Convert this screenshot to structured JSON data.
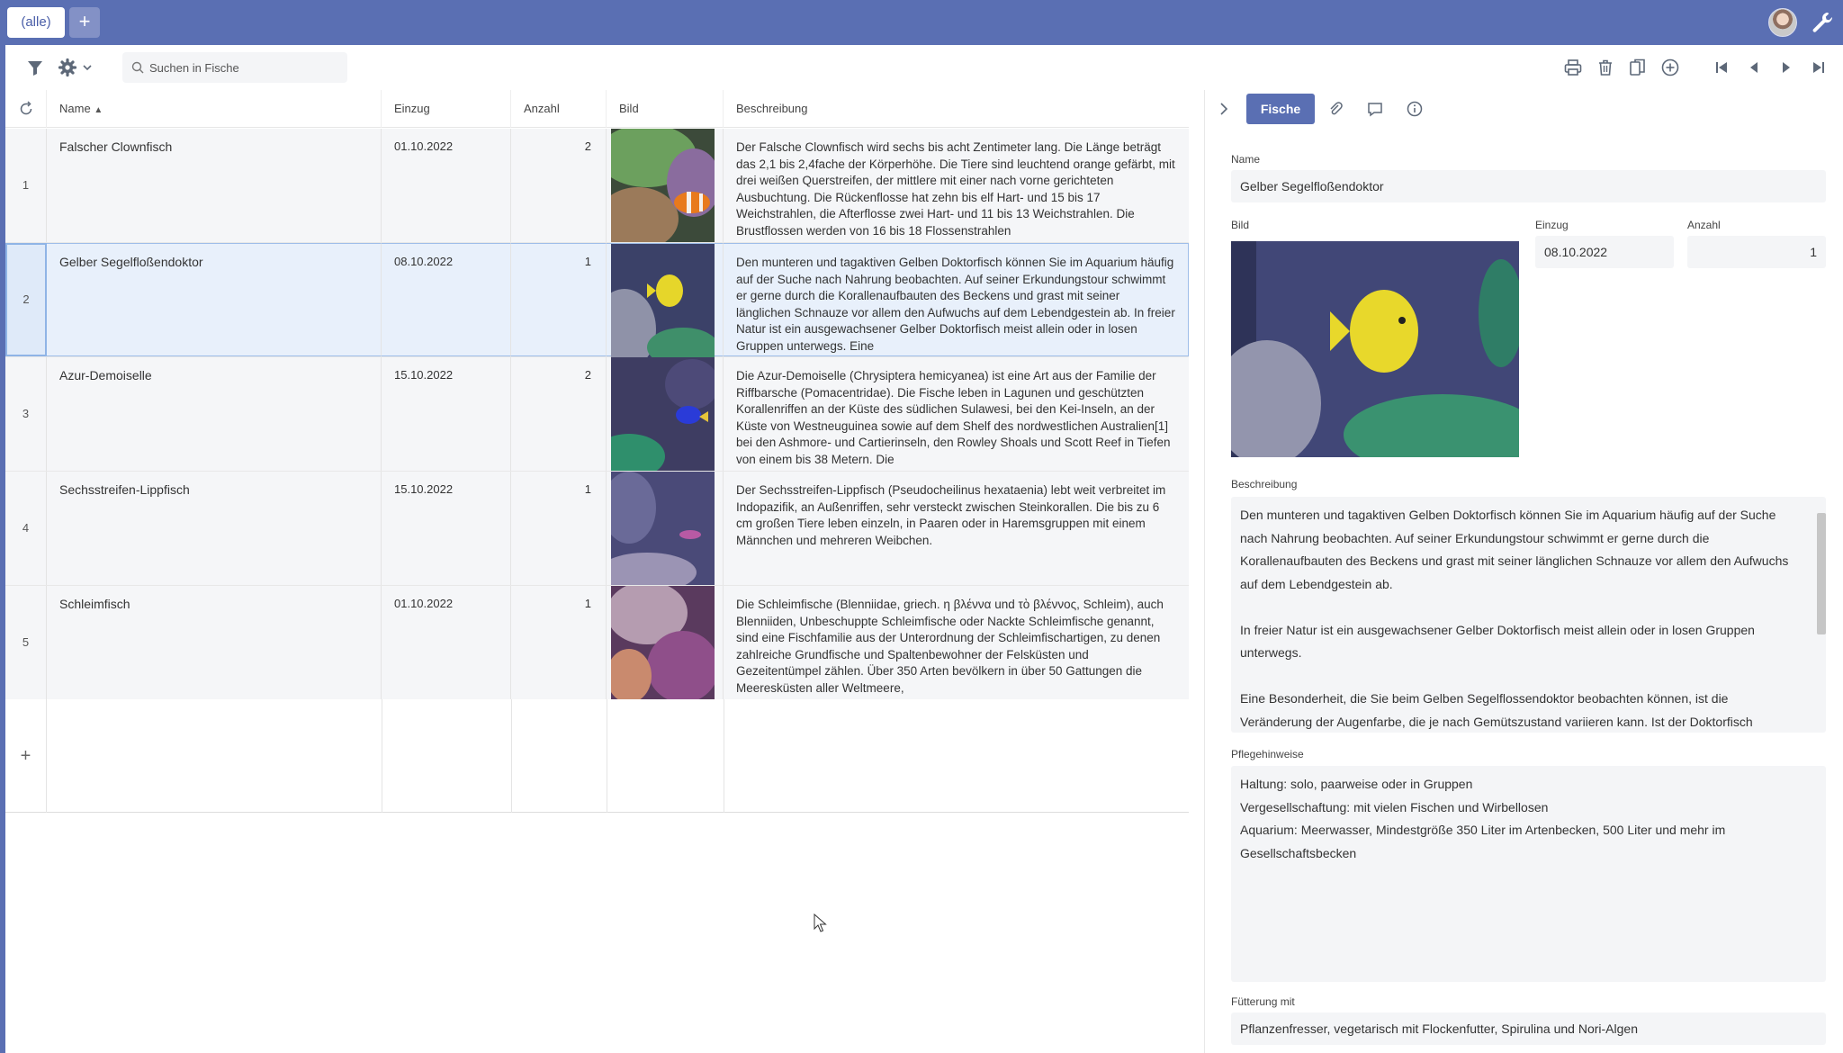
{
  "tabs": {
    "all_label": "(alle)",
    "add_label": "+"
  },
  "toolbar": {
    "search_placeholder": "Suchen in Fische",
    "icons": [
      "filter-icon",
      "settings-icon",
      "print-icon",
      "trash-icon",
      "copy-icon",
      "add-circle-icon",
      "first-record-icon",
      "prev-record-icon",
      "next-record-icon",
      "last-record-icon"
    ]
  },
  "grid": {
    "columns": {
      "name": "Name",
      "einzug": "Einzug",
      "anzahl": "Anzahl",
      "bild": "Bild",
      "beschreibung": "Beschreibung"
    },
    "sort_column": "Name",
    "rows": [
      {
        "num": "1",
        "name": "Falscher Clownfisch",
        "einzug": "01.10.2022",
        "anzahl": "2",
        "beschreibung": "Der Falsche Clownfisch wird sechs bis acht Zentimeter lang. Die Länge beträgt das 2,1 bis 2,4fache der Körperhöhe. Die Tiere sind leuchtend orange gefärbt, mit drei weißen Querstreifen, der mittlere mit einer nach vorne gerichteten Ausbuchtung. Die Rückenflosse hat zehn bis elf Hart- und 15 bis 17 Weichstrahlen, die Afterflosse zwei Hart- und 11 bis 13 Weichstrahlen. Die Brustflossen werden von 16 bis 18 Flossenstrahlen"
      },
      {
        "num": "2",
        "name": "Gelber Segelfloßendoktor",
        "einzug": "08.10.2022",
        "anzahl": "1",
        "beschreibung": "Den munteren und tagaktiven Gelben Doktorfisch können Sie im Aquarium häufig auf der Suche nach Nahrung beobachten. Auf seiner Erkundungstour schwimmt er gerne durch die Korallenaufbauten des Beckens und grast mit seiner länglichen Schnauze vor allem den Aufwuchs auf dem Lebendgestein ab. In freier Natur ist ein ausgewachsener Gelber Doktorfisch meist allein oder in losen Gruppen unterwegs. Eine"
      },
      {
        "num": "3",
        "name": "Azur-Demoiselle",
        "einzug": "15.10.2022",
        "anzahl": "2",
        "beschreibung": "Die Azur-Demoiselle (Chrysiptera hemicyanea) ist eine Art aus der Familie der Riffbarsche (Pomacentridae). Die Fische leben in Lagunen und geschützten Korallenriffen an der Küste des südlichen Sulawesi, bei den Kei-Inseln, an der Küste von Westneuguinea sowie auf dem Shelf des nordwestlichen Australien[1] bei den Ashmore- und Cartierinseln, den Rowley Shoals und Scott Reef in Tiefen von einem bis 38 Metern. Die"
      },
      {
        "num": "4",
        "name": "Sechsstreifen-Lippfisch",
        "einzug": "15.10.2022",
        "anzahl": "1",
        "beschreibung": "Der Sechsstreifen-Lippfisch (Pseudocheilinus hexataenia) lebt weit verbreitet im Indopazifik, an Außenriffen, sehr versteckt zwischen Steinkorallen. Die bis zu 6 cm großen Tiere leben einzeln, in Paaren oder in Haremsgruppen mit einem Männchen und mehreren Weibchen."
      },
      {
        "num": "5",
        "name": "Schleimfisch",
        "einzug": "01.10.2022",
        "anzahl": "1",
        "beschreibung": "Die Schleimfische (Blenniidae, griech. η βλέννα und τὸ βλέννος, Schleim), auch Blenniiden, Unbeschuppte Schleimfische oder Nackte Schleimfische genannt, sind eine Fischfamilie aus der Unterordnung der Schleimfischartigen, zu denen zahlreiche Grundfische und Spaltenbewohner der Felsküsten und Gezeitentümpel zählen. Über 350 Arten bevölkern in über 50 Gattungen die Meeresküsten aller Weltmeere,"
      }
    ],
    "add_row_label": "+"
  },
  "detail": {
    "tab_label": "Fische",
    "tab_icons": [
      "paperclip-icon",
      "comment-icon",
      "info-icon"
    ],
    "name_label": "Name",
    "name_value": "Gelber Segelfloßendoktor",
    "bild_label": "Bild",
    "einzug_label": "Einzug",
    "einzug_value": "08.10.2022",
    "anzahl_label": "Anzahl",
    "anzahl_value": "1",
    "beschreibung_label": "Beschreibung",
    "beschreibung_value": "Den munteren und tagaktiven Gelben Doktorfisch können Sie im Aquarium häufig auf der Suche nach Nahrung beobachten. Auf seiner Erkundungstour schwimmt er gerne durch die Korallenaufbauten des Beckens und grast mit seiner länglichen Schnauze vor allem den Aufwuchs auf dem Lebendgestein ab.\n\nIn freier Natur ist ein ausgewachsener Gelber Doktorfisch meist allein oder in losen Gruppen unterwegs.\n\nEine Besonderheit, die Sie beim Gelben Segelflossendoktor beobachten können, ist die Veränderung der Augenfarbe, die je nach Gemütszustand variieren kann. Ist der Doktorfisch",
    "pflege_label": "Pflegehinweise",
    "pflege_value": "Haltung: solo, paarweise oder in Gruppen\nVergesellschaftung: mit vielen Fischen und Wirbellosen\nAquarium: Meerwasser, Mindestgröße 350 Liter im Artenbecken, 500 Liter und mehr im Gesellschaftsbecken",
    "fuetterung_label": "Fütterung mit",
    "fuetterung_value": "Pflanzenfresser, vegetarisch mit Flockenfutter, Spirulina und Nori-Algen"
  },
  "colors": {
    "accent": "#5a6fb3",
    "selected_row": "#e8f0fb",
    "row_bg": "#f5f6f8",
    "field_bg": "#f4f5f7"
  }
}
